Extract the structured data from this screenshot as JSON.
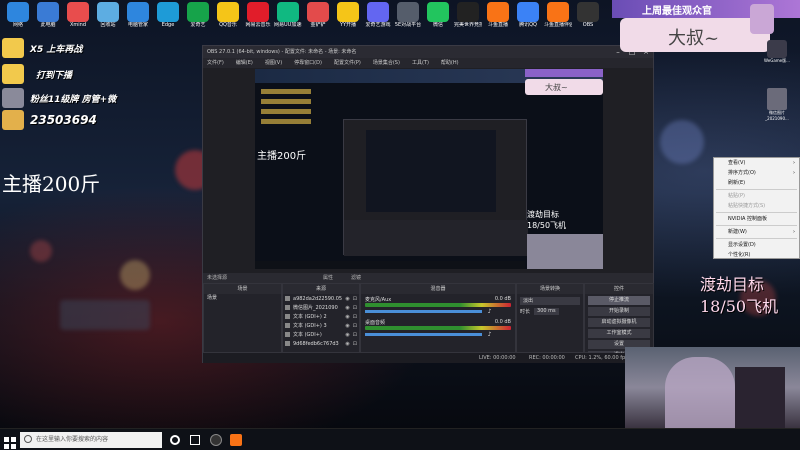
{
  "desktop_icons": [
    {
      "label": "网络",
      "color": "#2e86de"
    },
    {
      "label": "此电脑",
      "color": "#3a7bd5"
    },
    {
      "label": "Xmind",
      "color": "#e84d4d"
    },
    {
      "label": "回收站",
      "color": "#5dade2"
    },
    {
      "label": "电脑管家",
      "color": "#2e86de"
    },
    {
      "label": "Edge",
      "color": "#1e9bd7"
    },
    {
      "label": "爱奇艺",
      "color": "#16a34a"
    },
    {
      "label": "QQ音乐",
      "color": "#f5c518"
    },
    {
      "label": "网易云音乐",
      "color": "#e11d2a"
    },
    {
      "label": "网易UU加速器",
      "color": "#10b981"
    },
    {
      "label": "金铲铲",
      "color": "#e34b4b"
    },
    {
      "label": "YY开播",
      "color": "#f5c518"
    },
    {
      "label": "爱奇艺游戏",
      "color": "#6366f1"
    },
    {
      "label": "5E对战平台",
      "color": "#555d6b"
    },
    {
      "label": "微信",
      "color": "#22c55e"
    },
    {
      "label": "完美世界竞技平台",
      "color": "#222222"
    },
    {
      "label": "斗鱼直播",
      "color": "#f97316"
    },
    {
      "label": "腾讯QQ",
      "color": "#3b82f6"
    },
    {
      "label": "斗鱼直播伴侣",
      "color": "#f97316"
    },
    {
      "label": "OBS",
      "color": "#333333"
    },
    {
      "label": "上周最佳观众",
      "color": "#7c3aed"
    }
  ],
  "overlay": {
    "row1": "X5 上车再战",
    "row2": "打到下播",
    "row3": "粉丝11级牌 房管+微",
    "row4": "23503694",
    "weight": "主播200斤"
  },
  "top_banner": "上周最佳观众官",
  "chat_bubble": "大叔~",
  "right_panel": {
    "goal_line1": "渡劫目标",
    "goal_line2": "18/50飞机"
  },
  "obs": {
    "title": "OBS 27.0.1 (64-bit, windows) - 配置文件: 未命名 - 场景: 未命名",
    "menu": [
      "文件(F)",
      "编辑(E)",
      "视图(V)",
      "停靠窗口(D)",
      "配置文件(P)",
      "场景集合(S)",
      "工具(T)",
      "帮助(H)"
    ],
    "source_missing": "未选择源",
    "props_label": "属性",
    "filters_label": "滤镜",
    "docks": {
      "scenes_title": "场景",
      "sources_title": "来源",
      "mixer_title": "混音器",
      "transitions_title": "场景转换",
      "controls_title": "控件"
    },
    "scene_item": "场景",
    "sources": [
      {
        "name": "a982da2d22590.05"
      },
      {
        "name": "微信图片_2021090"
      },
      {
        "name": "文本 (GDI+) 2"
      },
      {
        "name": "文本 (GDI+) 3"
      },
      {
        "name": "文本 (GDI+)"
      },
      {
        "name": "9d68fedb6c767d3"
      }
    ],
    "mixer": [
      {
        "name": "麦克风/Aux",
        "db": "0.0 dB"
      },
      {
        "name": "桌面音频",
        "db": "0.0 dB"
      }
    ],
    "transition": {
      "type": "淡出",
      "duration_label": "时长",
      "duration_value": "300 ms"
    },
    "controls": [
      "停止推流",
      "开始录制",
      "启动虚拟摄像机",
      "工作室模式",
      "设置",
      "退出"
    ],
    "status": {
      "live": "LIVE: 00:00:00",
      "rec": "REC: 00:00:00",
      "cpu": "CPU: 1.2%, 60.00 fps"
    }
  },
  "context_menu": [
    {
      "label": "查看(V)",
      "arrow": true
    },
    {
      "label": "排序方式(O)",
      "arrow": true
    },
    {
      "label": "刷新(E)",
      "arrow": false
    },
    {
      "sep": true
    },
    {
      "label": "粘贴(P)",
      "arrow": false,
      "disabled": true
    },
    {
      "label": "粘贴快捷方式(S)",
      "arrow": false,
      "disabled": true
    },
    {
      "sep": true
    },
    {
      "label": "NVIDIA 控制面板",
      "arrow": false
    },
    {
      "sep": true
    },
    {
      "label": "新建(W)",
      "arrow": true
    },
    {
      "sep": true
    },
    {
      "label": "显示设置(D)",
      "arrow": false
    },
    {
      "label": "个性化(R)",
      "arrow": false
    }
  ],
  "right_desktop_icons": [
    {
      "label": "WeGame版..."
    },
    {
      "label": "微信图片_2021090..."
    }
  ],
  "taskbar": {
    "search_placeholder": "在这里输入你要搜索的内容"
  }
}
